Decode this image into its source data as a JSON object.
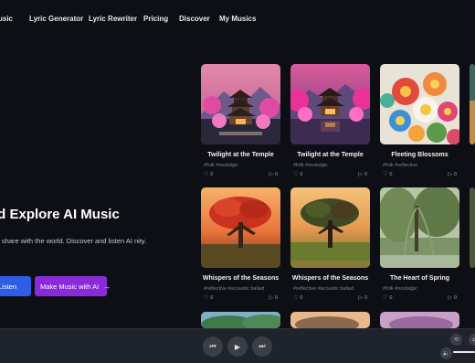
{
  "nav": {
    "items": [
      "AI Music",
      "Lyric Generator",
      "Lyric Rewriter",
      "Pricing",
      "Discover",
      "My Musics"
    ],
    "item0_visible": "usic"
  },
  "hero": {
    "title": "Create and Explore AI Music",
    "title_visible": "nd Explore AI Music",
    "subtitle_visible": "J, share with the world. Discover and listen AI nity.",
    "listen_label": "Listen",
    "make_label": "Make Music with AI",
    "arrow": "→"
  },
  "cards": [
    {
      "title": "Twilight at the Temple",
      "tags": "#folk #nostalgic",
      "likes": "0",
      "plays": "0",
      "art": "temple"
    },
    {
      "title": "Twilight at the Temple",
      "tags": "#folk #nostalgic",
      "likes": "0",
      "plays": "0",
      "art": "temple-lake"
    },
    {
      "title": "Fleeting Blossoms",
      "tags": "#folk #reflective",
      "likes": "0",
      "plays": "0",
      "art": "flowers"
    },
    {
      "title": "Whispers of the Seasons",
      "tags": "#reflective #acoustic ballad",
      "likes": "0",
      "plays": "0",
      "art": "tree-sunset"
    },
    {
      "title": "Whispers of the Seasons",
      "tags": "#reflective #acoustic ballad",
      "likes": "0",
      "plays": "0",
      "art": "tree-meadow"
    },
    {
      "title": "The Heart of Spring",
      "tags": "#folk #nostalgic",
      "likes": "0",
      "plays": "0",
      "art": "willow"
    }
  ],
  "player": {
    "prev_icon": "skip-back-icon",
    "play_icon": "play-icon",
    "next_icon": "skip-forward-icon",
    "repeat_icon": "repeat-icon",
    "volume_icon": "volume-icon"
  },
  "colors": {
    "background": "#0d0f15",
    "listen_button": "#2f5ee6",
    "make_button": "#8a2bd9",
    "player_bar": "#1f232c"
  }
}
